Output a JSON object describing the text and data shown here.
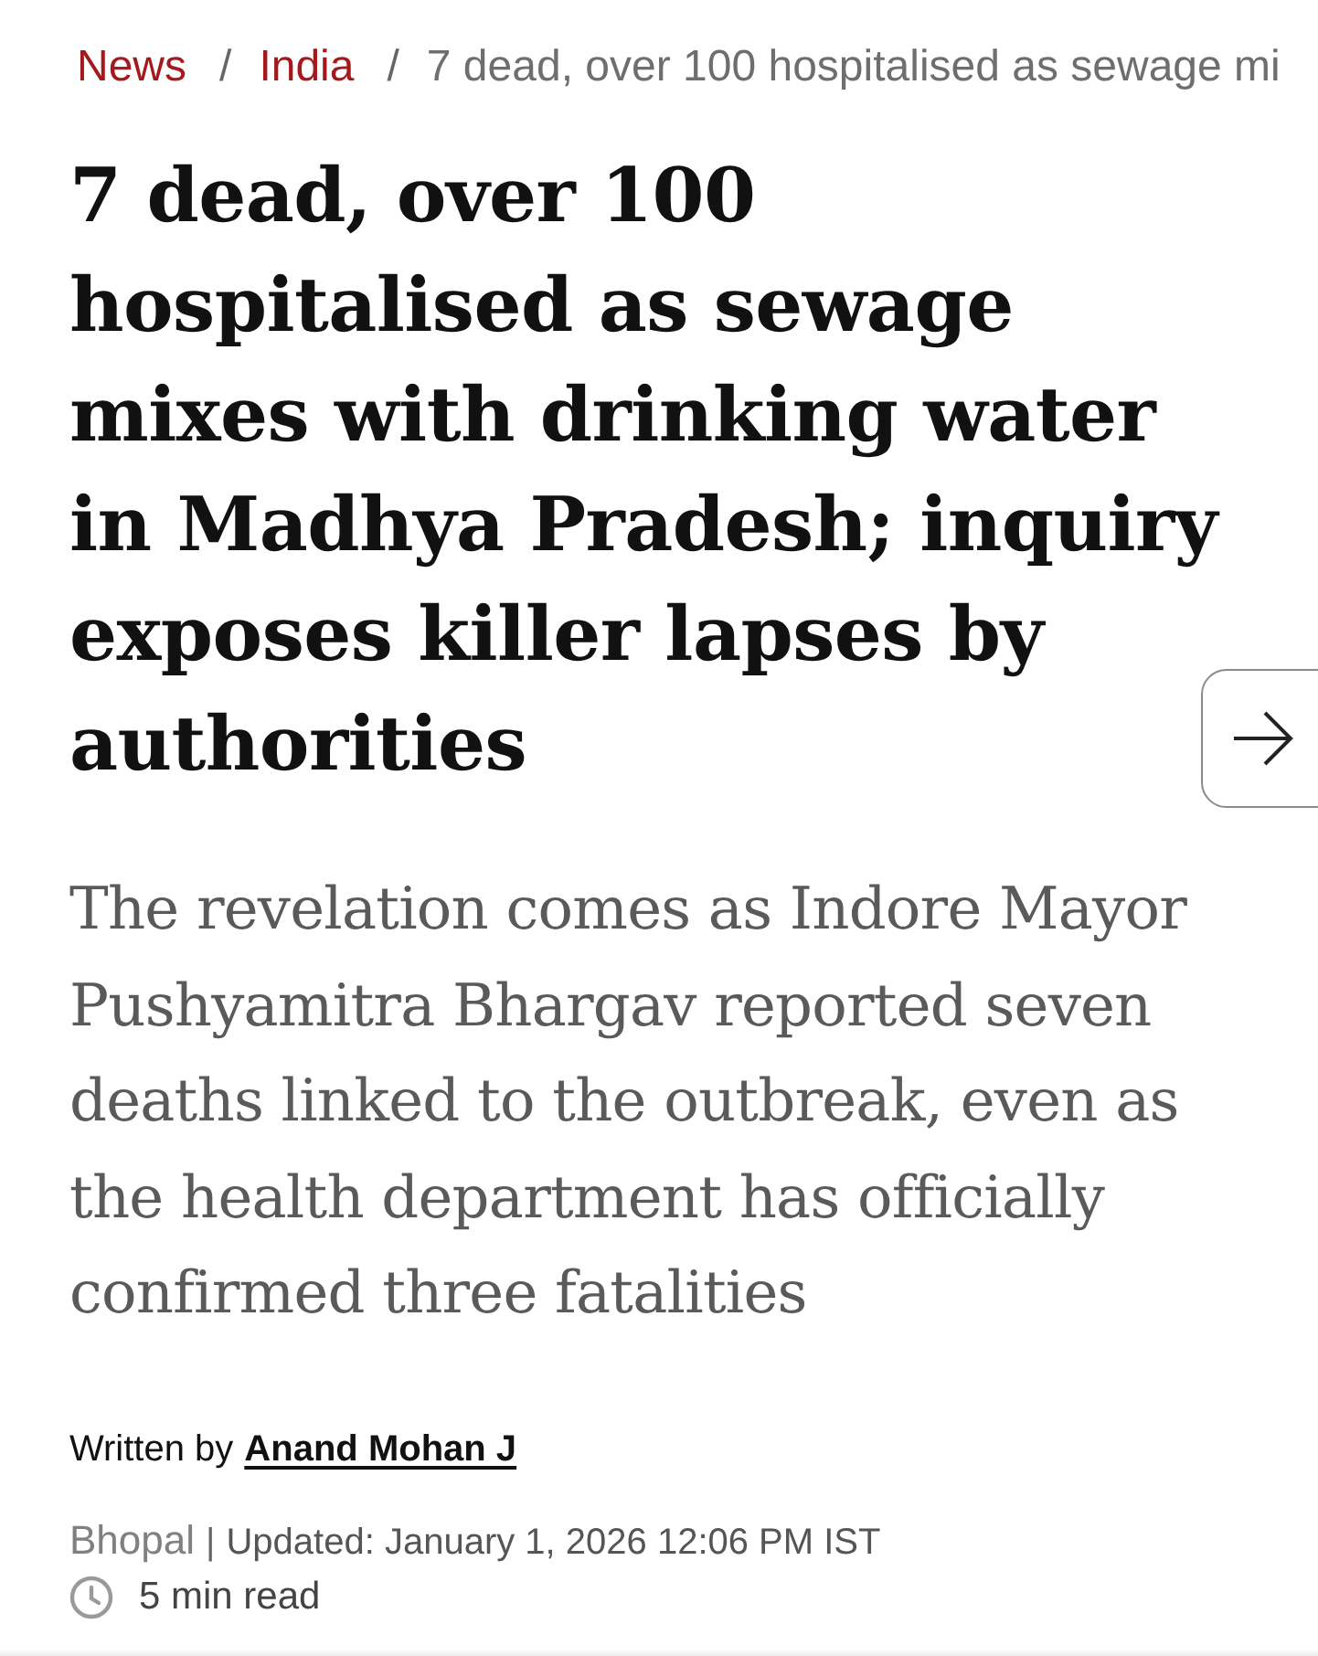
{
  "breadcrumb": [
    {
      "label": "News",
      "kind": "link"
    },
    {
      "separator": "/",
      "label": "India",
      "kind": "link"
    },
    {
      "separator": "/",
      "label": "7 dead, over 100 hospitalised as sewage mi",
      "kind": "current"
    }
  ],
  "headline": "7 dead, over 100 hospitalised as sewage mixes with drinking water in Madhya Pradesh; inquiry exposes killer lapses by authorities",
  "summary": "The revelation comes as Indore Mayor Pushyamitra Bhargav reported seven deaths linked to the outbreak, even as the health department has officially confirmed three fatalities",
  "byline": {
    "prefix": "Written by",
    "author": "Anand Mohan J"
  },
  "meta": {
    "location": "Bhopal",
    "separator": "|",
    "updated": "Updated: January 1, 2026 12:06 PM IST",
    "read_time": "5 min read"
  }
}
